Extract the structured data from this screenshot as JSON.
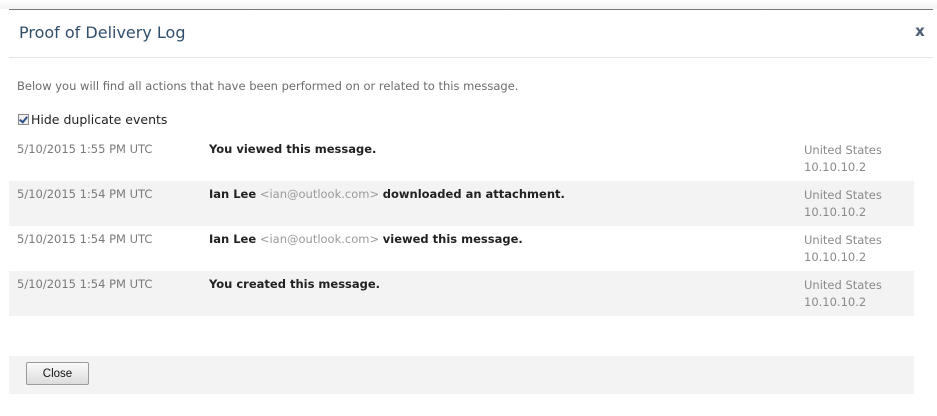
{
  "dialog": {
    "title": "Proof of Delivery Log",
    "close_icon_glyph": "x",
    "intro": "Below you will find all actions that have been performed on or related to this message.",
    "hide_duplicates_label": "Hide duplicate events",
    "hide_duplicates_checked": true,
    "close_button_label": "Close"
  },
  "events": [
    {
      "time": "5/10/2015 1:55 PM UTC",
      "name": "",
      "email": "",
      "action": "You viewed this message.",
      "location": "United States",
      "ip": "10.10.10.2"
    },
    {
      "time": "5/10/2015 1:54 PM UTC",
      "name": "Ian Lee",
      "email": "<ian@outlook.com>",
      "action": "downloaded an attachment.",
      "location": "United States",
      "ip": "10.10.10.2"
    },
    {
      "time": "5/10/2015 1:54 PM UTC",
      "name": "Ian Lee",
      "email": "<ian@outlook.com>",
      "action": "viewed this message.",
      "location": "United States",
      "ip": "10.10.10.2"
    },
    {
      "time": "5/10/2015 1:54 PM UTC",
      "name": "",
      "email": "",
      "action": "You created this message.",
      "location": "United States",
      "ip": "10.10.10.2"
    }
  ],
  "colors": {
    "title": "#2f4f6b",
    "row_alt": "#f3f3f3"
  }
}
